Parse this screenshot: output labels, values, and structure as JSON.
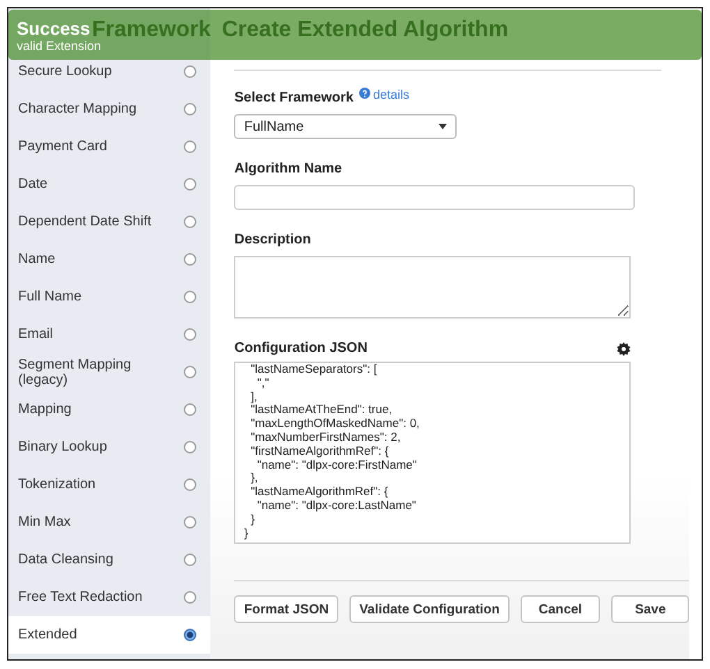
{
  "toast": {
    "title": "Success",
    "message": "valid Extension"
  },
  "sidebar": {
    "title": "Framework",
    "items": [
      {
        "label": "Secure Lookup",
        "selected": false
      },
      {
        "label": "Character Mapping",
        "selected": false
      },
      {
        "label": "Payment Card",
        "selected": false
      },
      {
        "label": "Date",
        "selected": false
      },
      {
        "label": "Dependent Date Shift",
        "selected": false
      },
      {
        "label": "Name",
        "selected": false
      },
      {
        "label": "Full Name",
        "selected": false
      },
      {
        "label": "Email",
        "selected": false
      },
      {
        "label": "Segment Mapping (legacy)",
        "selected": false
      },
      {
        "label": "Mapping",
        "selected": false
      },
      {
        "label": "Binary Lookup",
        "selected": false
      },
      {
        "label": "Tokenization",
        "selected": false
      },
      {
        "label": "Min Max",
        "selected": false
      },
      {
        "label": "Data Cleansing",
        "selected": false
      },
      {
        "label": "Free Text Redaction",
        "selected": false
      },
      {
        "label": "Extended",
        "selected": true
      }
    ]
  },
  "main": {
    "title": "Create Extended Algorithm",
    "framework": {
      "label": "Select Framework",
      "link": "details",
      "value": "FullName"
    },
    "algorithm_name": {
      "label": "Algorithm Name"
    },
    "description": {
      "label": "Description"
    },
    "config": {
      "label": "Configuration JSON",
      "lines": [
        "  \"lastNameSeparators\": [",
        "    \",\"",
        "  ],",
        "  \"lastNameAtTheEnd\": true,",
        "  \"maxLengthOfMaskedName\": 0,",
        "  \"maxNumberFirstNames\": 2,",
        "  \"firstNameAlgorithmRef\": {",
        "    \"name\": \"dlpx-core:FirstName\"",
        "  },",
        "  \"lastNameAlgorithmRef\": {",
        "    \"name\": \"dlpx-core:LastName\"",
        "  }",
        "}"
      ]
    },
    "buttons": [
      "Format JSON",
      "Validate Configuration",
      "Cancel",
      "Save"
    ]
  }
}
